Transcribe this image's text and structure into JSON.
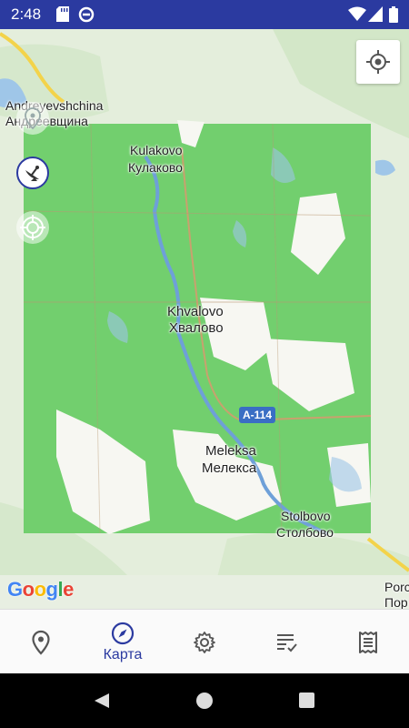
{
  "status_bar": {
    "time": "2:48",
    "icons": [
      "sd-card-icon",
      "data-saver-icon",
      "wifi-icon",
      "signal-icon",
      "battery-icon"
    ]
  },
  "map": {
    "places": [
      {
        "en": "Andreyevshchina",
        "ru": "Андреевщина"
      },
      {
        "en": "Kulakovo",
        "ru": "Кулаково"
      },
      {
        "en": "Khvalovo",
        "ru": "Хвалово"
      },
      {
        "en": "Meleksa",
        "ru": "Мелекса"
      },
      {
        "en": "Stolbovo",
        "ru": "Столбово"
      },
      {
        "en": "Porc",
        "ru": "Пор"
      }
    ],
    "road_shield": "A-114",
    "attribution": "Google",
    "colors": {
      "overlay_green": "#72cf6e",
      "base_land": "#e6efe0",
      "water": "#9fc6e8",
      "road": "#f3d34a"
    }
  },
  "bottom_nav": {
    "items": [
      {
        "icon": "map-pin-icon",
        "label": ""
      },
      {
        "icon": "compass-icon",
        "label": "Карта"
      },
      {
        "icon": "gear-icon",
        "label": ""
      },
      {
        "icon": "checklist-icon",
        "label": ""
      },
      {
        "icon": "receipt-icon",
        "label": ""
      }
    ],
    "active_color": "#2b3aa0"
  },
  "system_nav": [
    "back-button",
    "home-button",
    "recents-button"
  ]
}
